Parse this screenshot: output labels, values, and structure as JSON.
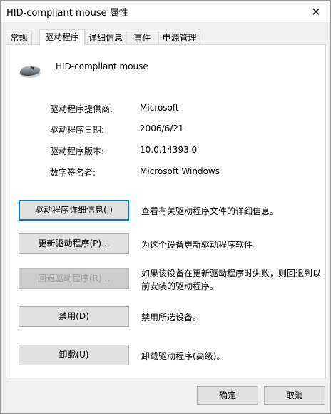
{
  "window": {
    "title": "HID-compliant mouse 属性",
    "close_glyph": "✕"
  },
  "tabs": [
    {
      "label": "常规",
      "active": false
    },
    {
      "label": "驱动程序",
      "active": true
    },
    {
      "label": "详细信息",
      "active": false
    },
    {
      "label": "事件",
      "active": false
    },
    {
      "label": "电源管理",
      "active": false
    }
  ],
  "device": {
    "name": "HID-compliant mouse",
    "icon": "mouse-icon"
  },
  "driver_info": [
    {
      "label": "驱动程序提供商:",
      "value": "Microsoft"
    },
    {
      "label": "驱动程序日期:",
      "value": "2006/6/21"
    },
    {
      "label": "驱动程序版本:",
      "value": "10.0.14393.0"
    },
    {
      "label": "数字签名者:",
      "value": "Microsoft Windows"
    }
  ],
  "actions": [
    {
      "label": "驱动程序详细信息(I)",
      "description": "查看有关驱动程序文件的详细信息。",
      "enabled": true
    },
    {
      "label": "更新驱动程序(P)...",
      "description": "为这个设备更新驱动程序软件。",
      "enabled": true
    },
    {
      "label": "回退驱动程序(R)...",
      "description": "如果该设备在更新驱动程序时失败，则回退到以前安装的驱动程序。",
      "enabled": false
    },
    {
      "label": "禁用(D)",
      "description": "禁用所选设备。",
      "enabled": true
    },
    {
      "label": "卸载(U)",
      "description": "卸载驱动程序(高级)。",
      "enabled": true
    }
  ],
  "footer": {
    "ok_label": "确定",
    "cancel_label": "取消"
  },
  "colors": {
    "focus_border": "#0078d7",
    "panel_bg": "#ffffff",
    "window_bg": "#f0f0f0"
  }
}
